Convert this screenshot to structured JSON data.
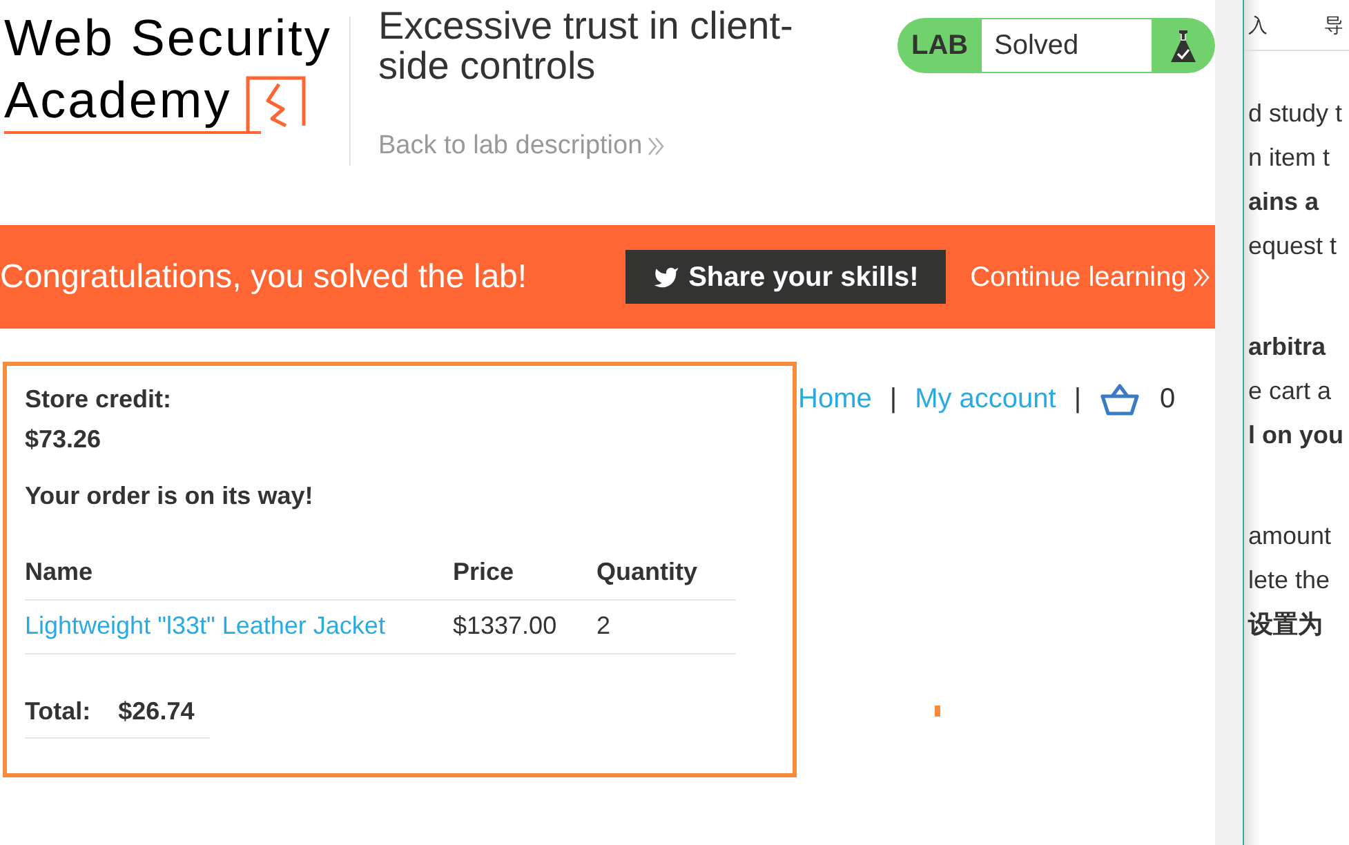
{
  "header": {
    "logo": {
      "lines": [
        "Web Security",
        "Academy"
      ]
    },
    "lab_title": "Excessive trust in client-side controls",
    "back_link": "Back to lab description",
    "lab_status": {
      "label": "LAB",
      "status": "Solved",
      "solved": true
    }
  },
  "banner": {
    "message": "Congratulations, you solved the lab!",
    "share_button": "Share your skills!",
    "continue_link": "Continue learning"
  },
  "nav": {
    "items": [
      {
        "kind": "link",
        "label": "Home"
      },
      {
        "kind": "separator",
        "label": "|"
      },
      {
        "kind": "link",
        "label": "My account"
      },
      {
        "kind": "separator",
        "label": "|"
      },
      {
        "kind": "cart",
        "count": "0"
      }
    ]
  },
  "order": {
    "store_credit_label": "Store credit:",
    "store_credit": "$73.26",
    "message": "Your order is on its way!",
    "table": {
      "columns": [
        "Name",
        "Price",
        "Quantity"
      ],
      "rows": [
        {
          "name": "Lightweight \"l33t\" Leather Jacket",
          "price": "$1337.00",
          "quantity": "2"
        }
      ]
    },
    "total": {
      "label": "Total:",
      "value": "$26.74"
    }
  },
  "side_window": {
    "menu": [
      "入",
      "导"
    ],
    "paragraphs": [
      [
        {
          "text": "d study t",
          "bold": false
        },
        {
          "text": "n item t",
          "bold": false
        },
        {
          "text": "ains a",
          "bold": true
        },
        {
          "text": "equest t",
          "bold": false
        }
      ],
      [
        {
          "text": "arbitra",
          "bold": true
        },
        {
          "text": "e cart a",
          "bold": false
        },
        {
          "text": "l on you",
          "bold": true
        }
      ],
      [
        {
          "text": "amount",
          "bold": false
        },
        {
          "text": "lete the",
          "bold": false
        },
        {
          "text": "设置为",
          "bold": true
        }
      ]
    ]
  }
}
